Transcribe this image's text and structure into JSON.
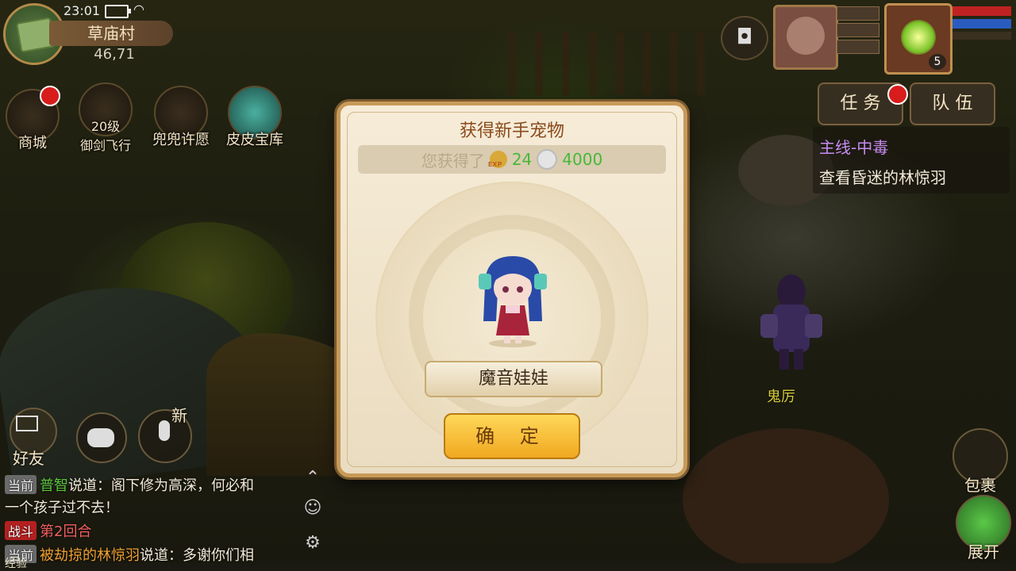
{
  "status": {
    "time": "23:01"
  },
  "location": {
    "name": "草庙村",
    "coords": "46,71"
  },
  "features": {
    "shop": "商城",
    "sword_flight_level": "20级",
    "sword_flight": "御剑飞行",
    "wish": "兜兜许愿",
    "treasure": "皮皮宝库"
  },
  "dialog": {
    "title": "获得新手宠物",
    "obtained_label": "您获得了",
    "exp_value": "24",
    "coin_value": "4000",
    "pet_name": "魔音娃娃",
    "confirm_label": "确 定"
  },
  "player": {
    "level": "5"
  },
  "tabs": {
    "task": "任 务",
    "team": "队 伍"
  },
  "quest": {
    "title": "主线-中毒",
    "desc": "查看昏迷的林惊羽"
  },
  "npc": {
    "name": "鬼厉"
  },
  "social": {
    "friends": "好友",
    "new_badge": "新"
  },
  "chat": {
    "line1": {
      "tag": "当前",
      "name": "普智",
      "text": "说道：阁下修为高深，何必和"
    },
    "line1b": "一个孩子过不去！",
    "line2": {
      "tag": "战斗",
      "text": "第2回合"
    },
    "line3": {
      "tag": "当前",
      "name": "被劫掠的林惊羽",
      "text": "说道：多谢你们相"
    }
  },
  "bottom_right": {
    "bag": "包裹",
    "expand": "展开"
  },
  "exp_bar": {
    "label": "经验"
  },
  "colors": {
    "dialog_border": "#c89a58",
    "confirm_button": "#f0a820",
    "quest_title": "#c68cf0"
  }
}
